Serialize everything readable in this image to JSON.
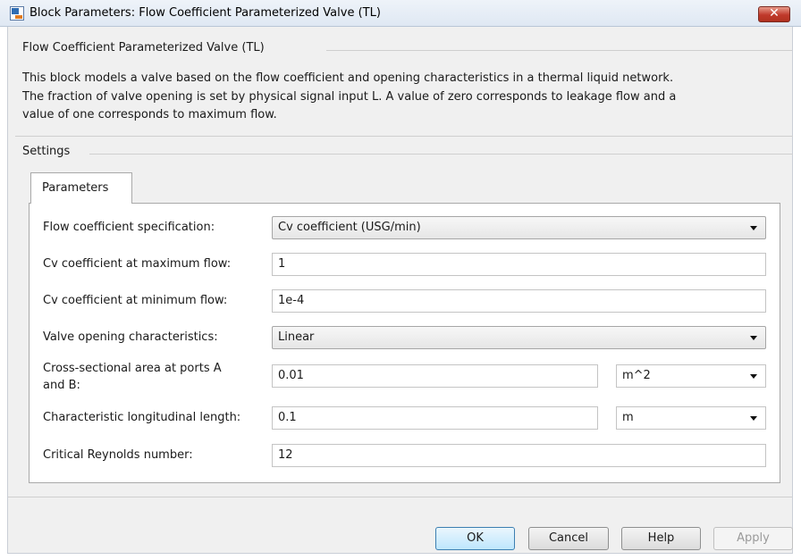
{
  "window": {
    "title": "Block Parameters: Flow Coefficient Parameterized Valve (TL)",
    "close_glyph": "✕"
  },
  "block": {
    "name": "Flow Coefficient Parameterized Valve (TL)",
    "description_lines": [
      "This block models a valve based on the flow coefficient and opening characteristics in a thermal liquid network.",
      "The fraction of valve opening is set by physical signal input L. A value of zero corresponds to leakage flow and a",
      "value of one corresponds to maximum flow."
    ]
  },
  "settings": {
    "label": "Settings",
    "tab_label": "Parameters"
  },
  "params": {
    "flow_coeff_spec": {
      "label": "Flow coefficient specification:",
      "value": "Cv coefficient (USG/min)"
    },
    "cv_max": {
      "label": "Cv coefficient at maximum flow:",
      "value": "1"
    },
    "cv_min": {
      "label": "Cv coefficient at minimum flow:",
      "value": "1e-4"
    },
    "opening_char": {
      "label": "Valve opening characteristics:",
      "value": "Linear"
    },
    "area": {
      "label_line1": "Cross-sectional area at ports A",
      "label_line2": "and B:",
      "value": "0.01",
      "unit": "m^2"
    },
    "length": {
      "label": "Characteristic longitudinal length:",
      "value": "0.1",
      "unit": "m"
    },
    "reynolds": {
      "label": "Critical Reynolds number:",
      "value": "12"
    }
  },
  "buttons": {
    "ok": "OK",
    "cancel": "Cancel",
    "help": "Help",
    "apply": "Apply"
  },
  "colors": {
    "close_button": "#c0392b",
    "ok_border": "#3c7fb1"
  }
}
